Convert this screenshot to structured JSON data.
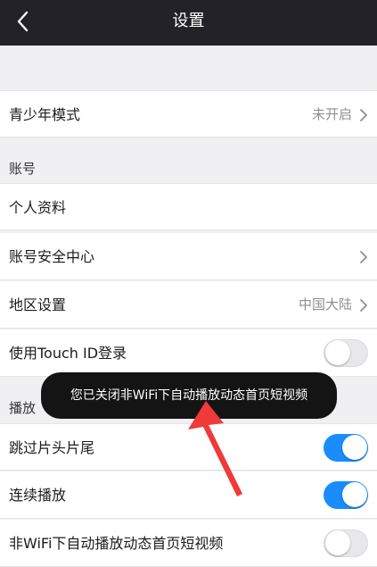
{
  "header": {
    "title": "设置"
  },
  "rows": {
    "youth_mode": {
      "label": "青少年模式",
      "value": "未开启"
    },
    "account_header": "账号",
    "profile": {
      "label": "个人资料"
    },
    "security": {
      "label": "账号安全中心"
    },
    "region": {
      "label": "地区设置",
      "value": "中国大陆"
    },
    "touch_id": {
      "label": "使用Touch ID登录",
      "toggle": false
    },
    "play_header": "播放",
    "skip_intro": {
      "label": "跳过片头片尾",
      "toggle": true
    },
    "continuous": {
      "label": "连续播放",
      "toggle": true
    },
    "autoplay_wifi": {
      "label": "非WiFi下自动播放动态首页短视频",
      "toggle": false
    }
  },
  "toast": {
    "message": "您已关闭非WiFi下自动播放动态首页短视频"
  },
  "colors": {
    "accent": "#1a8cff",
    "nav_bg": "#222228",
    "annotation_arrow": "#f03a3a"
  },
  "icons": {
    "back": "chevron-left-icon",
    "disclosure": "chevron-right-icon"
  }
}
